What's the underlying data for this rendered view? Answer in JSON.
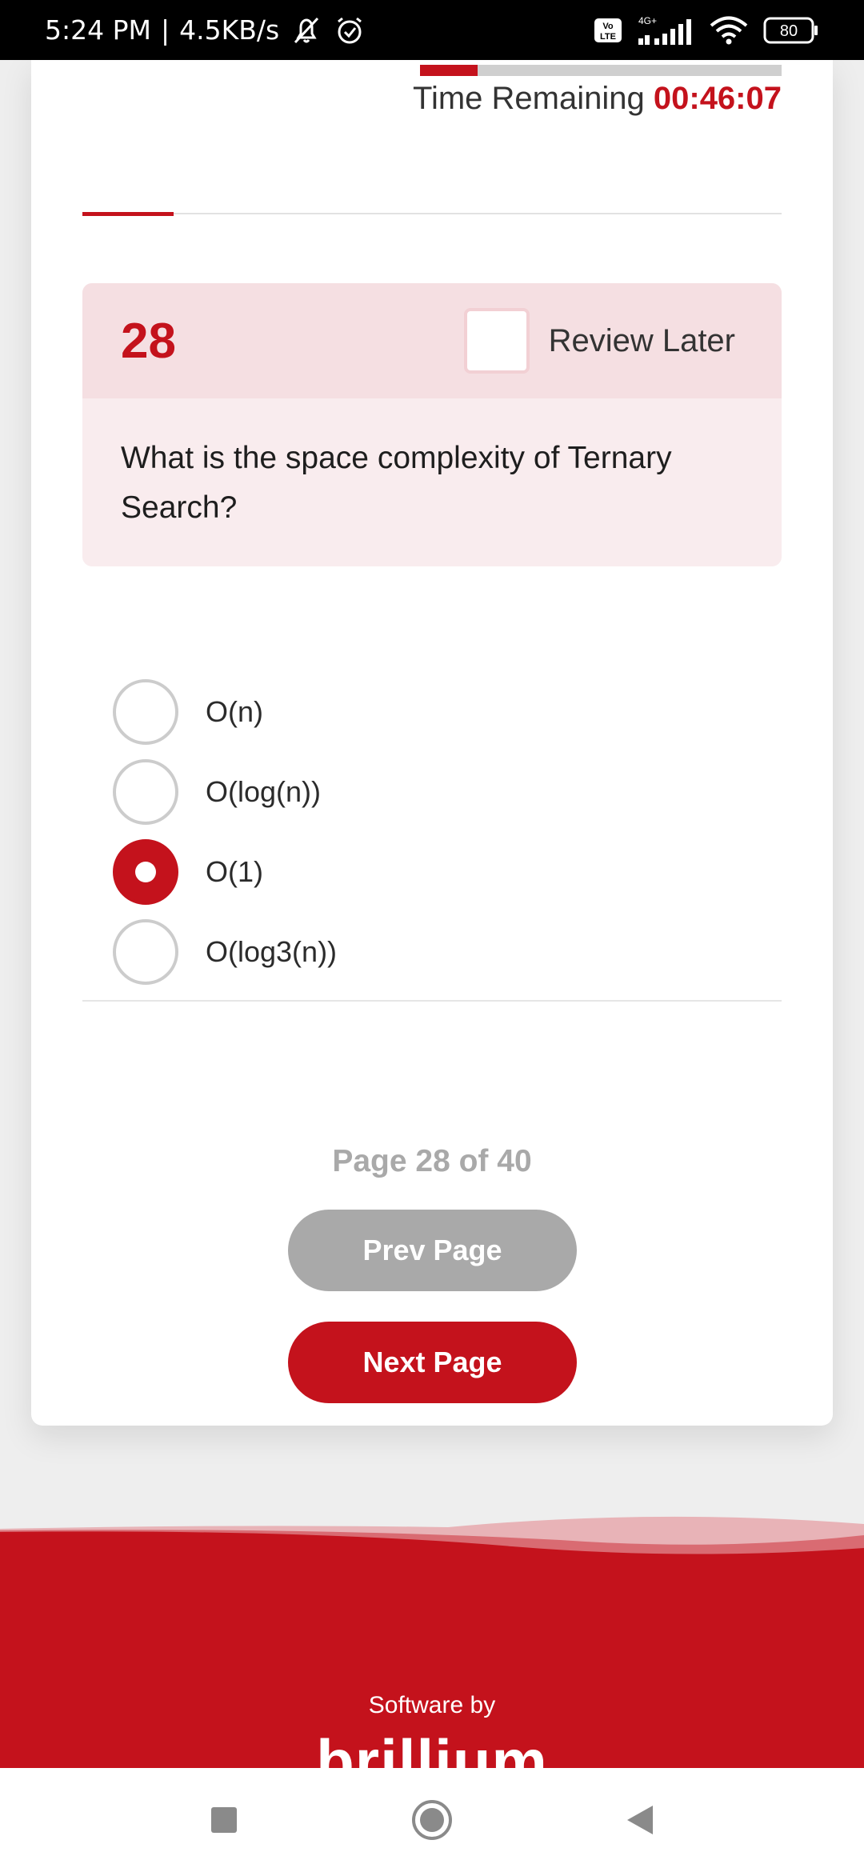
{
  "status_bar": {
    "time": "5:24 PM",
    "separator": "|",
    "speed": "4.5KB/s",
    "network": "4G+",
    "volte": "Vo LTE",
    "battery": "80"
  },
  "timer": {
    "label": "Time Remaining",
    "value": "00:46:07",
    "elapsed_fraction": 0.16
  },
  "section_progress_fraction": 0.13,
  "question": {
    "number": "28",
    "review_label": "Review Later",
    "review_checked": false,
    "text": "What is the space complexity of Ternary Search?"
  },
  "options": [
    {
      "label": "O(n)",
      "selected": false
    },
    {
      "label": "O(log(n))",
      "selected": false
    },
    {
      "label": "O(1)",
      "selected": true
    },
    {
      "label": "O(log3(n))",
      "selected": false
    }
  ],
  "pagination": {
    "indicator": "Page 28 of 40",
    "prev_label": "Prev Page",
    "next_label": "Next Page"
  },
  "footer": {
    "software_by": "Software by",
    "brand": "brillium"
  },
  "colors": {
    "accent": "#c4121c",
    "question_header_bg": "#f5dfe2",
    "question_body_bg": "#f9ecee",
    "disabled_button": "#a9a9a9"
  }
}
